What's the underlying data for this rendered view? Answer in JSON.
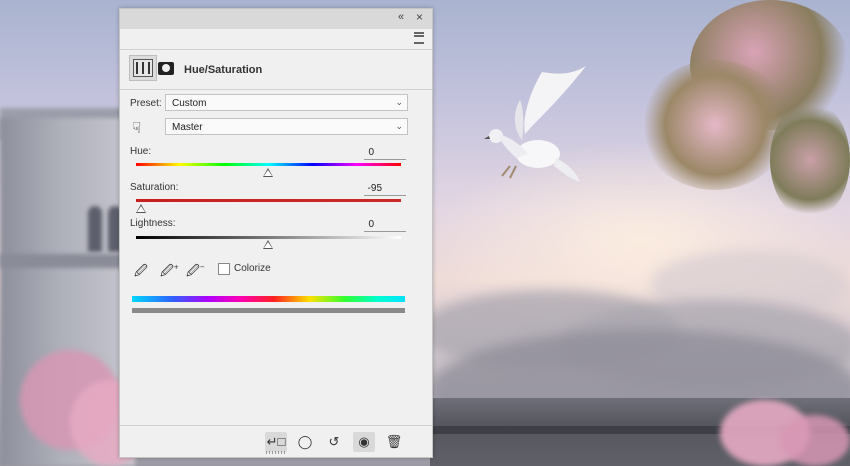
{
  "panel": {
    "heading": "Hue/Saturation",
    "icons": {
      "adjustment": "hue-saturation-adjustment-icon",
      "mask": "layer-mask-icon",
      "collapse": "double-chevron-icon",
      "close": "close-icon",
      "menu": "panel-menu-icon"
    }
  },
  "preset": {
    "label": "Preset:",
    "value": "Custom"
  },
  "channel": {
    "value": "Master"
  },
  "hue": {
    "label": "Hue:",
    "value": "0",
    "level": 0.5
  },
  "saturation": {
    "label": "Saturation:",
    "value": "-95",
    "level": 0.025
  },
  "lightness": {
    "label": "Lightness:",
    "value": "0",
    "level": 0.5
  },
  "colorize": {
    "label": "Colorize",
    "checked": false
  },
  "footer": {
    "buttons": [
      "clip-to-layer-icon",
      "view-previous-state-icon",
      "reset-icon",
      "toggle-visibility-icon",
      "delete-icon"
    ]
  }
}
